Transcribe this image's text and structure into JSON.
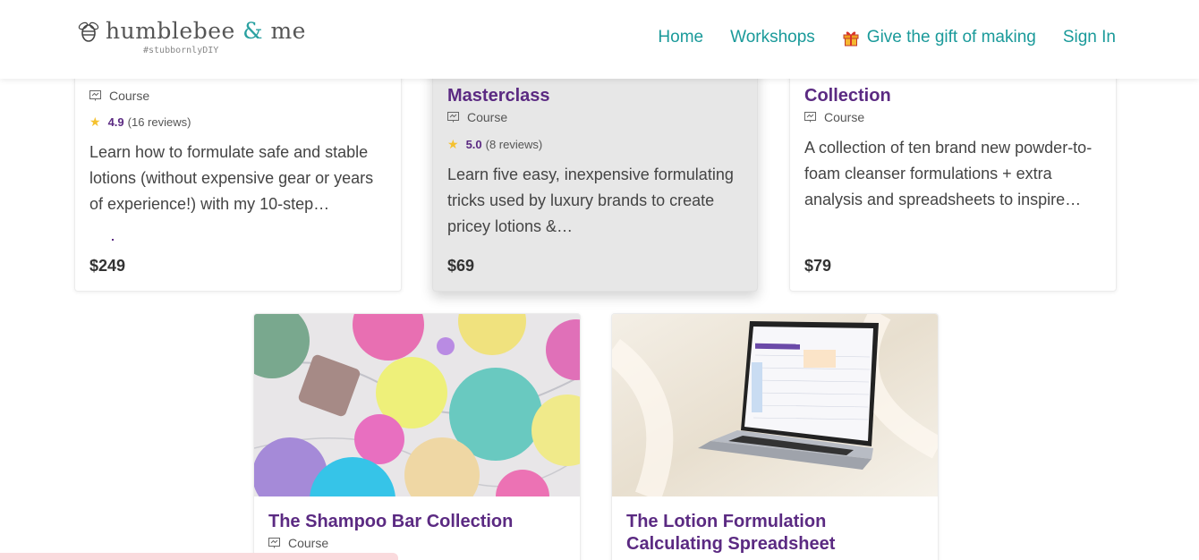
{
  "brand": {
    "name_part1": "humblebee",
    "name_amp": "&",
    "name_part2": "me",
    "tagline": "#stubbornlyDIY"
  },
  "nav": {
    "home": "Home",
    "workshops": "Workshops",
    "gift": "Give the gift of making",
    "signin": "Sign In"
  },
  "cards": [
    {
      "title": "",
      "type": "Course",
      "rating_score": "4.9",
      "rating_count": "(16 reviews)",
      "description": "Learn how to formulate safe and stable lotions (without expensive gear or years of experience!) with my 10-step…",
      "price": "$249"
    },
    {
      "title": "Masterclass",
      "type": "Course",
      "rating_score": "5.0",
      "rating_count": "(8 reviews)",
      "description": "Learn five easy, inexpensive formulating tricks used by luxury brands to create pricey lotions &…",
      "price": "$69"
    },
    {
      "title": "Collection",
      "type": "Course",
      "description": "A collection of ten brand new powder-to-foam cleanser formulations + extra analysis and spreadsheets to inspire…",
      "price": "$79"
    },
    {
      "title": "The Shampoo Bar Collection",
      "type": "Course"
    },
    {
      "title_line1": "The Lotion Formulation",
      "title_line2": "Calculating Spreadsheet"
    }
  ],
  "colors": {
    "accent_teal": "#1a9a9a",
    "title_purple": "#5b2a82",
    "star": "#f5c12e"
  }
}
